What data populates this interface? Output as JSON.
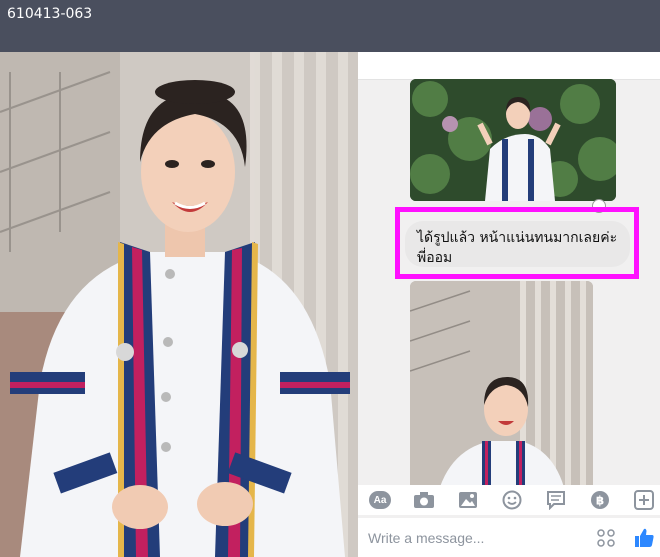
{
  "window": {
    "title": "610413-063"
  },
  "messenger": {
    "message_text": "ได้รูปแล้ว หน้าแน่นทนมากเลยค่ะพี่ออม",
    "composer_placeholder": "Write a message...",
    "toolbar": {
      "aa_label": "Aa",
      "icons": [
        "text-format-icon",
        "camera-icon",
        "image-icon",
        "emoji-icon",
        "message-bubble-icon",
        "baht-icon",
        "plus-icon"
      ]
    },
    "composer_icons": [
      "dots-grid-icon",
      "thumbs-up-icon"
    ]
  },
  "colors": {
    "topbar": "#4a4f5e",
    "highlight": "#ff10ff",
    "bubble": "#e9e8e8",
    "icon_gray": "#8d949e",
    "like_blue": "#2d88ff"
  }
}
